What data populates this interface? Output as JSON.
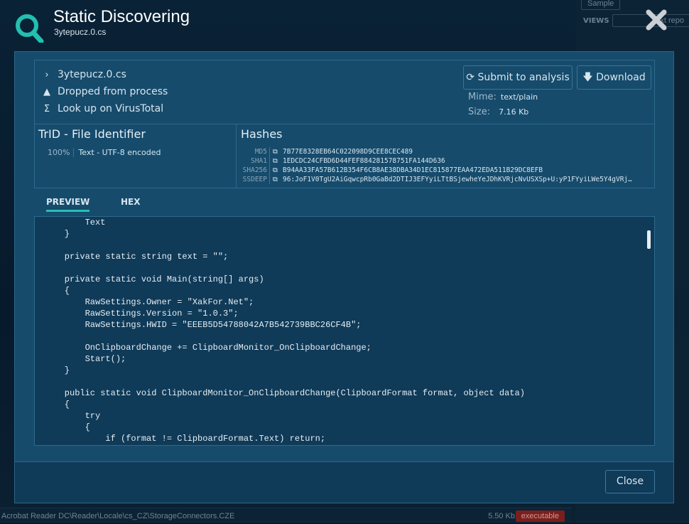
{
  "background": {
    "buttons": [
      "Sample",
      "VIEWS",
      "ext repo"
    ],
    "rows": [
      {
        "path": "Acrobat Reader DC\\Reader\\Locale\\cs_CZ\\StorageConnectors.CZE",
        "size": "5.50 Kb",
        "badge": "executable"
      }
    ]
  },
  "header": {
    "title": "Static Discovering",
    "subtitle": "3ytepucz.0.cs",
    "icon": "search-icon"
  },
  "info": {
    "filename": "3ytepucz.0.cs",
    "dropped": "Dropped from process",
    "virustotal": "Look up on VirusTotal",
    "submit_label": "Submit to analysis",
    "download_label": "Download",
    "mime_label": "Mime:",
    "mime_value": "text/plain",
    "size_label": "Size:",
    "size_value": "7.16 Kb"
  },
  "trid": {
    "title": "TrID - File Identifier",
    "entries": [
      {
        "percent": "100%",
        "desc": "Text - UTF-8 encoded"
      }
    ]
  },
  "hashes": {
    "title": "Hashes",
    "rows": [
      {
        "label": "MD5",
        "value": "7B77E8328EB64C022098D9CEE8CEC489"
      },
      {
        "label": "SHA1",
        "value": "1EDCDC24CFBD6D44FEF884281578751FA144D636"
      },
      {
        "label": "SHA256",
        "value": "B94AA33FA57B612B354F6CB8AE38DBA34D1EC815877EAA472EDA511B29DC8EFB"
      },
      {
        "label": "SSDEEP",
        "value": "96:JoF1V0TgU2AiGqwcpRb0GaBd2DTIJ3EFYyiLTtBSjewheYeJDhKVRjcNvUSXSp+U:yP1FYyiLWe5Y4gVRj…"
      }
    ]
  },
  "tabs": [
    {
      "label": "PREVIEW",
      "active": true
    },
    {
      "label": "HEX",
      "active": false
    }
  ],
  "preview": {
    "code": "        Text\n    }\n\n    private static string text = \"\";\n\n    private static void Main(string[] args)\n    {\n        RawSettings.Owner = \"XakFor.Net\";\n        RawSettings.Version = \"1.0.3\";\n        RawSettings.HWID = \"EEEB5D54788042A7B542739BBC26CF4B\";\n\n        OnClipboardChange += ClipboardMonitor_OnClipboardChange;\n        Start();\n    }\n\n    public static void ClipboardMonitor_OnClipboardChange(ClipboardFormat format, object data)\n    {\n        try\n        {\n            if (format != ClipboardFormat.Text) return;"
  },
  "footer": {
    "close_label": "Close"
  },
  "colors": {
    "accent": "#22c0b0",
    "dialog": "#164b6c",
    "footer": "#0f3a58"
  }
}
